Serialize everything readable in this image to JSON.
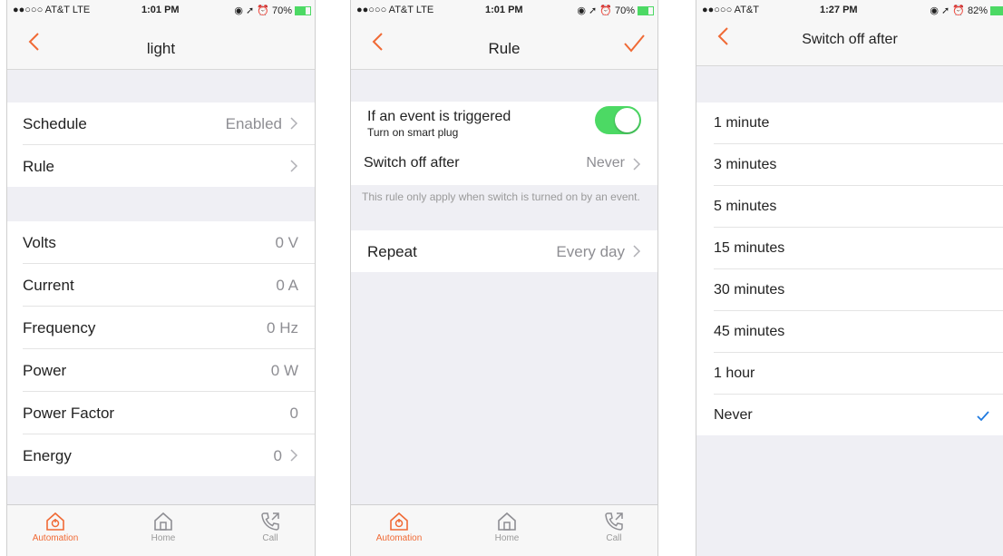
{
  "colors": {
    "accent": "#f06a35",
    "toggle_on": "#4cd964",
    "check": "#1f7ae0",
    "background": "#efeff4"
  },
  "screens": [
    {
      "status": {
        "carrier": "●●○○○ AT&T  LTE",
        "time": "1:01 PM",
        "battery": "70%",
        "battery_level": 0.7
      },
      "title": "light",
      "settings": [
        {
          "label": "Schedule",
          "value": "Enabled"
        },
        {
          "label": "Rule",
          "value": ""
        }
      ],
      "readings": [
        {
          "label": "Volts",
          "value": "0 V"
        },
        {
          "label": "Current",
          "value": "0 A"
        },
        {
          "label": "Frequency",
          "value": "0 Hz"
        },
        {
          "label": "Power",
          "value": "0 W"
        },
        {
          "label": "Power Factor",
          "value": "0"
        },
        {
          "label": "Energy",
          "value": "0"
        }
      ],
      "tabs": [
        {
          "label": "Automation",
          "icon": "automation-icon"
        },
        {
          "label": "Home",
          "icon": "home-icon"
        },
        {
          "label": "Call",
          "icon": "call-icon"
        }
      ]
    },
    {
      "status": {
        "carrier": "●●○○○ AT&T  LTE",
        "time": "1:01 PM",
        "battery": "70%",
        "battery_level": 0.7
      },
      "title": "Rule",
      "trigger": {
        "label": "If an event is triggered",
        "sublabel": "Turn on smart plug",
        "enabled": true
      },
      "switch_off": {
        "label": "Switch off after",
        "value": "Never"
      },
      "note": "This rule only apply when switch is turned on by an event.",
      "repeat": {
        "label": "Repeat",
        "value": "Every day"
      },
      "tabs": [
        {
          "label": "Automation",
          "icon": "automation-icon"
        },
        {
          "label": "Home",
          "icon": "home-icon"
        },
        {
          "label": "Call",
          "icon": "call-icon"
        }
      ]
    },
    {
      "status": {
        "carrier": "●●○○○ AT&T",
        "time": "1:27 PM",
        "battery": "82%",
        "battery_level": 0.82
      },
      "title": "Switch off after",
      "options": [
        "1 minute",
        "3 minutes",
        "5 minutes",
        "15 minutes",
        "30 minutes",
        "45 minutes",
        "1 hour",
        "Never"
      ],
      "selected": "Never"
    }
  ]
}
